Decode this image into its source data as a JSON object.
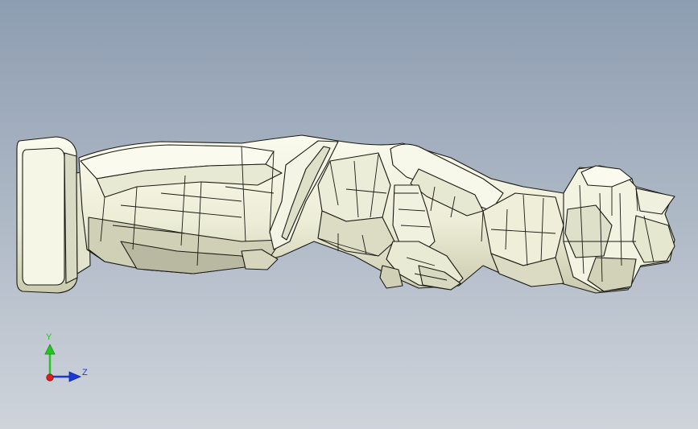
{
  "viewport": {
    "background_top": "#8d9db1",
    "background_bottom": "#cfd4db",
    "model": {
      "fill": "#f4f4e2",
      "shade": "#d7d8c0",
      "deep_shade": "#b9baa2",
      "edge": "#1a1a14"
    }
  },
  "triad": {
    "y_label": "Y",
    "z_label": "Z",
    "y_color": "#22c81e",
    "z_color": "#1a3ad8",
    "x_color": "#e01e1e"
  }
}
